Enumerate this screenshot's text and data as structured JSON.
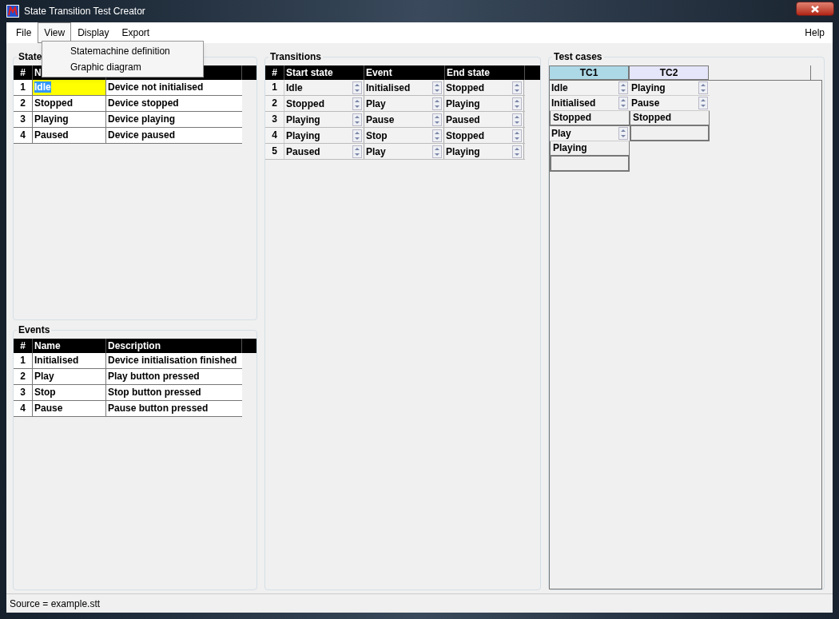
{
  "window": {
    "title": "State Transition Test Creator"
  },
  "menu": [
    {
      "label": "File",
      "open": false
    },
    {
      "label": "View",
      "open": true
    },
    {
      "label": "Display",
      "open": false
    },
    {
      "label": "Export",
      "open": false
    }
  ],
  "help_menu": "Help",
  "view_menu": [
    "Statemachine definition",
    "Graphic diagram"
  ],
  "states": {
    "title": "State",
    "columns": [
      "#",
      "N"
    ],
    "rows": [
      {
        "num": "1",
        "name": "Idle",
        "description": "Device not initialised",
        "selected": true
      },
      {
        "num": "2",
        "name": "Stopped",
        "description": "Device stopped",
        "selected": false
      },
      {
        "num": "3",
        "name": "Playing",
        "description": "Device playing",
        "selected": false
      },
      {
        "num": "4",
        "name": "Paused",
        "description": "Device paused",
        "selected": false
      }
    ]
  },
  "events": {
    "title": "Events",
    "columns": [
      "#",
      "Name",
      "Description"
    ],
    "rows": [
      {
        "num": "1",
        "name": "Initialised",
        "description": "Device initialisation finished"
      },
      {
        "num": "2",
        "name": "Play",
        "description": "Play button pressed"
      },
      {
        "num": "3",
        "name": "Stop",
        "description": "Stop button pressed"
      },
      {
        "num": "4",
        "name": "Pause",
        "description": "Pause button pressed"
      }
    ]
  },
  "transitions": {
    "title": "Transitions",
    "columns": [
      "#",
      "Start state",
      "Event",
      "End state"
    ],
    "rows": [
      {
        "num": "1",
        "start": "Idle",
        "event": "Initialised",
        "end": "Stopped"
      },
      {
        "num": "2",
        "start": "Stopped",
        "event": "Play",
        "end": "Playing"
      },
      {
        "num": "3",
        "start": "Playing",
        "event": "Pause",
        "end": "Paused"
      },
      {
        "num": "4",
        "start": "Playing",
        "event": "Stop",
        "end": "Stopped"
      },
      {
        "num": "5",
        "start": "Paused",
        "event": "Play",
        "end": "Playing"
      }
    ]
  },
  "test_cases": {
    "title": "Test cases",
    "columns": [
      {
        "label": "TC1",
        "selected": true,
        "cells": [
          {
            "kind": "select",
            "text": "Idle"
          },
          {
            "kind": "select",
            "text": "Initialised"
          },
          {
            "kind": "state",
            "text": "Stopped"
          },
          {
            "kind": "select",
            "text": "Play"
          },
          {
            "kind": "state",
            "text": "Playing"
          },
          {
            "kind": "blank"
          }
        ]
      },
      {
        "label": "TC2",
        "selected": false,
        "cells": [
          {
            "kind": "select",
            "text": "Playing"
          },
          {
            "kind": "select",
            "text": "Pause"
          },
          {
            "kind": "state",
            "text": "Stopped"
          },
          {
            "kind": "blank"
          }
        ]
      }
    ]
  },
  "status_bar": "Source = example.stt"
}
